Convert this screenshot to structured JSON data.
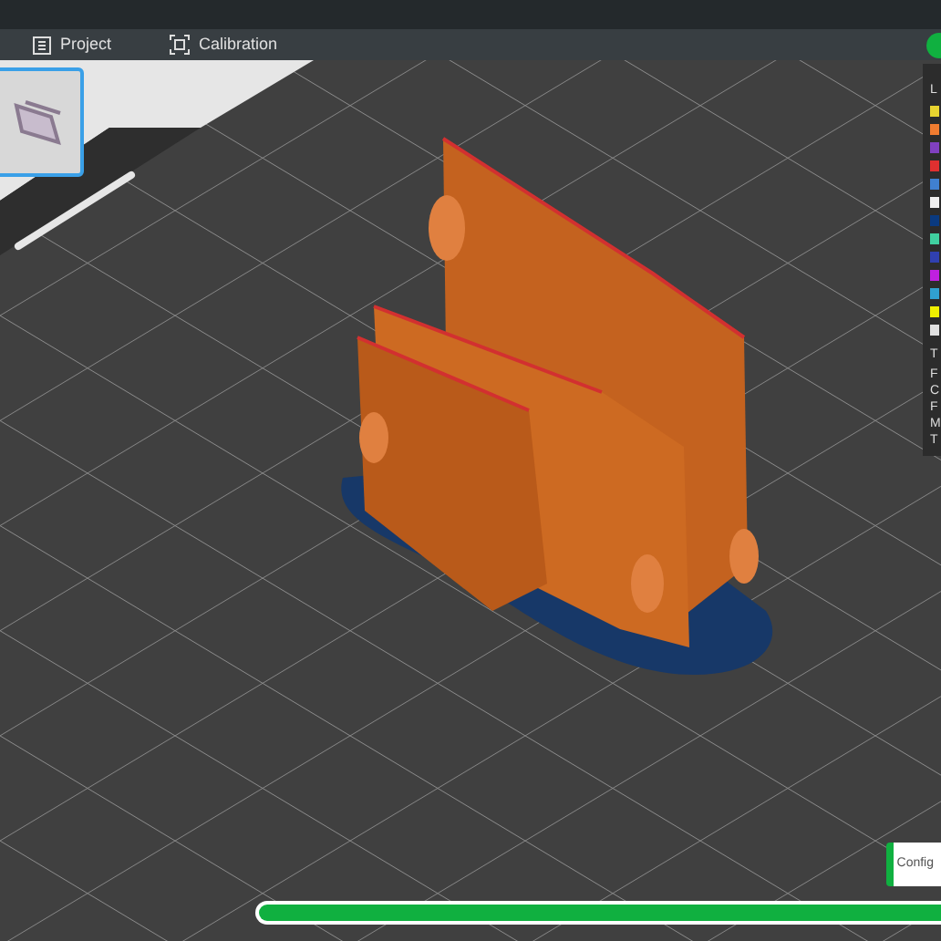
{
  "tabs": [
    {
      "label": "Project",
      "selected": false
    },
    {
      "label": "Calibration",
      "selected": false
    }
  ],
  "status": {
    "color": "#10b040"
  },
  "legend": {
    "header": "L",
    "items": [
      {
        "color": "#e8d430"
      },
      {
        "color": "#f07c30"
      },
      {
        "color": "#8040c0"
      },
      {
        "color": "#e03030"
      },
      {
        "color": "#4080d0"
      },
      {
        "color": "#f0f0f0"
      },
      {
        "color": "#0a3a80"
      },
      {
        "color": "#40d0a0"
      },
      {
        "color": "#3040b0"
      },
      {
        "color": "#c020e0"
      },
      {
        "color": "#30a0d0"
      },
      {
        "color": "#f0f000"
      },
      {
        "color": "#e0e0e0"
      }
    ],
    "footer_title": "T",
    "rows": [
      "F",
      "C",
      "F",
      "M",
      "T"
    ]
  },
  "toast": {
    "text": "Config"
  },
  "progress": {
    "level": 1
  }
}
